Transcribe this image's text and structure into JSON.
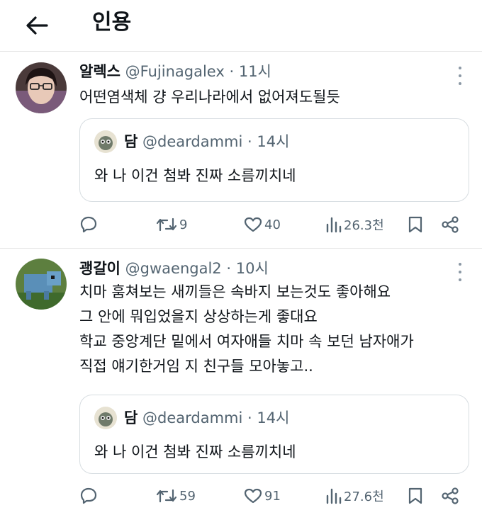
{
  "header": {
    "title": "인용"
  },
  "tweets": [
    {
      "name": "알렉스",
      "handle": "@Fujinagalex",
      "dot": "·",
      "time": "11시",
      "lines": [
        "어떤염색체 걍 우리나라에서 없어져도될듯"
      ],
      "quote": {
        "name": "담",
        "handle": "@deardammi",
        "dot": "·",
        "time": "14시",
        "text": "와 나 이건 첨봐 진짜 소름끼치네"
      },
      "stats": {
        "replies": "",
        "retweets": "9",
        "likes": "40",
        "views": "26.3천"
      }
    },
    {
      "name": "괭갈이",
      "handle": "@gwaengal2",
      "dot": "·",
      "time": "10시",
      "lines": [
        "치마 훔쳐보는 새끼들은 속바지 보는것도 좋아해요",
        "그 안에 뭐입었을지 상상하는게 좋대요",
        "학교 중앙계단 밑에서 여자애들 치마 속 보던 남자애가",
        "직접 얘기한거임 지 친구들 모아놓고.."
      ],
      "quote": {
        "name": "담",
        "handle": "@deardammi",
        "dot": "·",
        "time": "14시",
        "text": "와 나 이건 첨봐 진짜 소름끼치네"
      },
      "stats": {
        "replies": "",
        "retweets": "59",
        "likes": "91",
        "views": "27.6천"
      }
    }
  ],
  "colors": {
    "text": "#0f1419",
    "secondary": "#536471",
    "border": "#d7dde1"
  }
}
